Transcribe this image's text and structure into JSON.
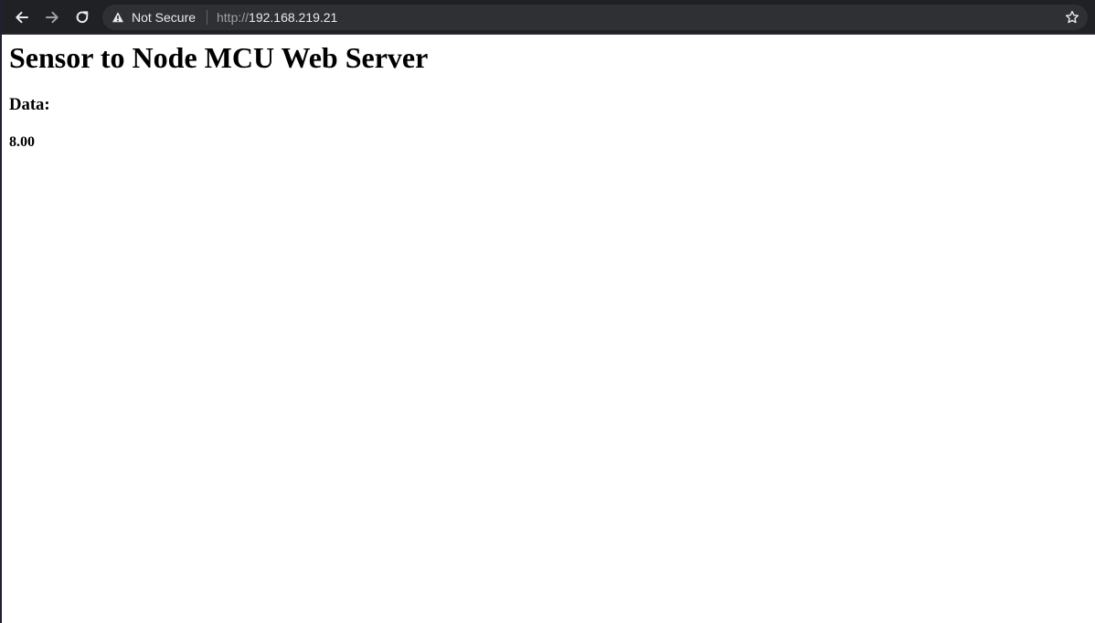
{
  "browser": {
    "security_text": "Not Secure",
    "url_scheme": "http://",
    "url_host": "192.168.219.21",
    "icons": {
      "back": "back-arrow-icon",
      "forward": "forward-arrow-icon",
      "reload": "reload-icon",
      "warning": "warning-icon",
      "bookmark": "star-icon"
    },
    "colors": {
      "toolbar": "#202124",
      "omnibox": "#2f3033",
      "text": "#e8eaed",
      "muted": "#9aa0a6"
    }
  },
  "page": {
    "heading": "Sensor to Node MCU Web Server",
    "data_label": "Data:",
    "data_value": "8.00"
  }
}
